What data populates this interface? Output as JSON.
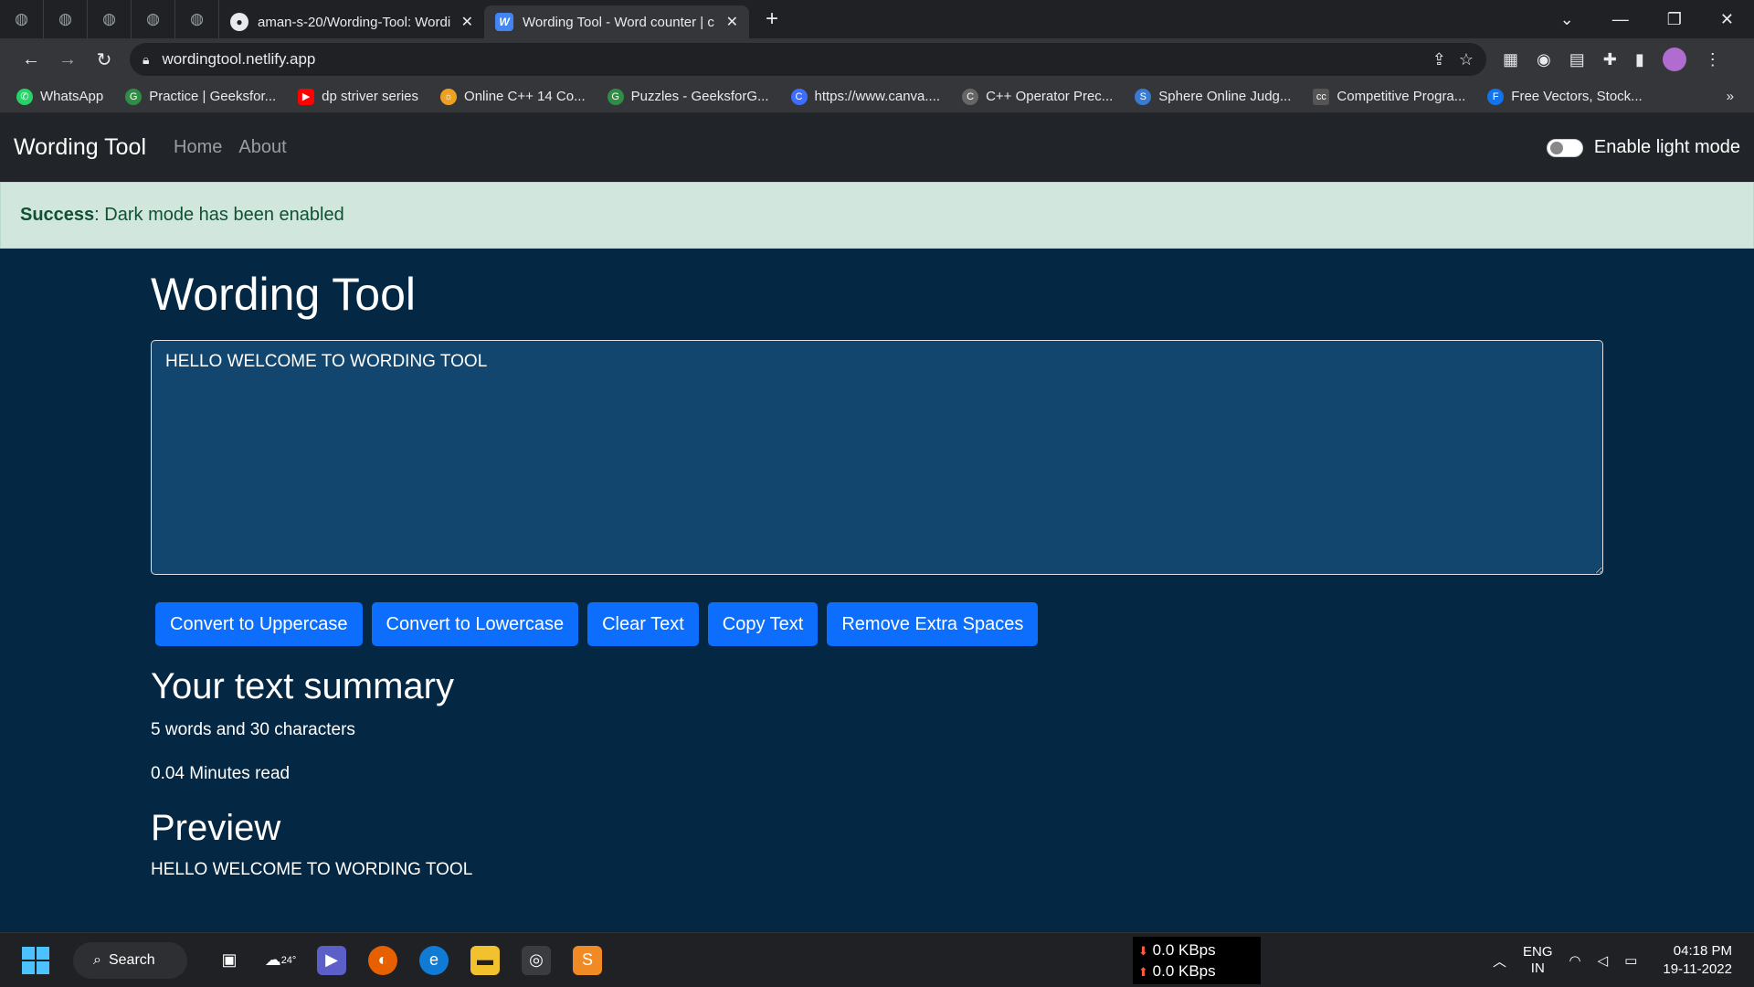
{
  "browser": {
    "tabs": [
      {
        "title": "aman-s-20/Wording-Tool: Wordi",
        "active": false,
        "favicon": "github-icon"
      },
      {
        "title": "Wording Tool - Word counter | c",
        "active": true,
        "favicon": "w-icon"
      }
    ],
    "url": "wordingtool.netlify.app",
    "bookmarks": [
      {
        "label": "WhatsApp",
        "icon": "whatsapp-icon",
        "color": "#25d366"
      },
      {
        "label": "Practice | Geeksfor...",
        "icon": "gfg-icon",
        "color": "#2f8d46"
      },
      {
        "label": "dp striver series",
        "icon": "youtube-icon",
        "color": "#ff0000"
      },
      {
        "label": "Online C++ 14 Co...",
        "icon": "sun-icon",
        "color": "#f0a020"
      },
      {
        "label": "Puzzles - GeeksforG...",
        "icon": "gfg-icon",
        "color": "#2f8d46"
      },
      {
        "label": "https://www.canva....",
        "icon": "canva-icon",
        "color": "#3d6eff"
      },
      {
        "label": "C++ Operator Prec...",
        "icon": "cpp-icon",
        "color": "#666666"
      },
      {
        "label": "Sphere Online Judg...",
        "icon": "spoj-icon",
        "color": "#3a7ad1"
      },
      {
        "label": "Competitive Progra...",
        "icon": "cc-icon",
        "color": "#555555"
      },
      {
        "label": "Free Vectors, Stock...",
        "icon": "freepik-icon",
        "color": "#1273eb"
      }
    ]
  },
  "navbar": {
    "brand": "Wording Tool",
    "links": [
      "Home",
      "About"
    ],
    "toggle_label": "Enable light mode"
  },
  "alert": {
    "strong": "Success",
    "message": ": Dark mode has been enabled"
  },
  "main": {
    "title": "Wording Tool",
    "textarea_value": "HELLO WELCOME TO WORDING TOOL",
    "buttons": [
      "Convert to Uppercase",
      "Convert to Lowercase",
      "Clear Text",
      "Copy Text",
      "Remove Extra Spaces"
    ],
    "summary_heading": "Your text summary",
    "summary_counts": "5 words and 30 characters",
    "read_time": "0.04 Minutes read",
    "preview_heading": "Preview",
    "preview_text": "HELLO WELCOME TO WORDING TOOL"
  },
  "taskbar": {
    "search_label": "Search",
    "weather": "24°",
    "net_down": "0.0 KBps",
    "net_up": "0.0 KBps",
    "lang_top": "ENG",
    "lang_bottom": "IN",
    "time": "04:18 PM",
    "date": "19-11-2022"
  },
  "colors": {
    "page_bg": "#042743",
    "textarea_bg": "#13466e",
    "button": "#0d6efd",
    "alert_bg": "#d1e7dd",
    "navbar_bg": "#212529"
  }
}
